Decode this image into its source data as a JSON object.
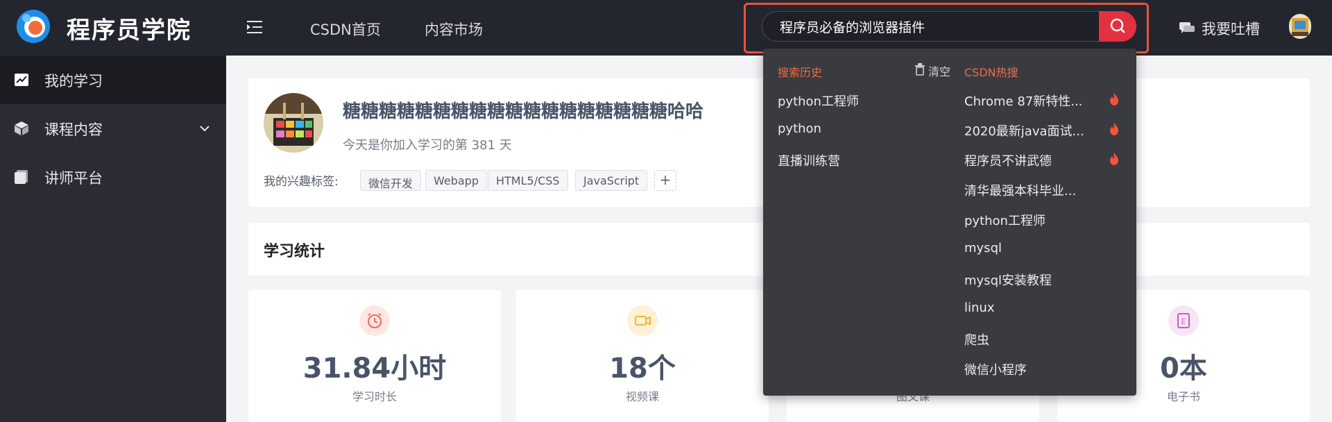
{
  "header": {
    "logo_text": "程序员学院",
    "nav": [
      "CSDN首页",
      "内容市场"
    ],
    "search": {
      "value": "程序员必备的浏览器插件"
    },
    "feedback_label": "我要吐槽"
  },
  "sidebar": {
    "items": [
      {
        "label": "我的学习",
        "icon": "chart-icon",
        "active": true
      },
      {
        "label": "课程内容",
        "icon": "cube-icon",
        "expandable": true
      },
      {
        "label": "讲师平台",
        "icon": "document-icon"
      }
    ]
  },
  "profile": {
    "name": "糖糖糖糖糖糖糖糖糖糖糖糖糖糖糖糖糖糖哈哈",
    "days_text": "今天是你加入学习的第 381 天",
    "tags_label": "我的兴趣标签:",
    "tags": [
      "微信开发",
      "Webapp",
      "HTML5/CSS",
      "JavaScript"
    ],
    "add_tag": "+"
  },
  "stats": {
    "title": "学习统计",
    "cards": [
      {
        "value": "31.84小时",
        "label": "学习时长",
        "icon": "alarm-clock-icon",
        "color": "#f0665c"
      },
      {
        "value": "18个",
        "label": "视频课",
        "icon": "video-icon",
        "color": "#f3b33a"
      },
      {
        "value": "",
        "label": "图文课",
        "icon": "article-icon",
        "color": "#5b8def"
      },
      {
        "value": "0本",
        "label": "电子书",
        "icon": "ebook-icon",
        "color": "#c45cc8"
      }
    ]
  },
  "dropdown": {
    "history_title": "搜索历史",
    "clear_label": "清空",
    "hot_title": "CSDN热搜",
    "history": [
      "python工程师",
      "python",
      "直播训练营"
    ],
    "hot": [
      {
        "text": "Chrome 87新特性...",
        "fire": true
      },
      {
        "text": "2020最新java面试...",
        "fire": true
      },
      {
        "text": "程序员不讲武德",
        "fire": true
      },
      {
        "text": "清华最强本科毕业...",
        "fire": false
      },
      {
        "text": "python工程师",
        "fire": false
      },
      {
        "text": "mysql",
        "fire": false
      },
      {
        "text": "mysql安装教程",
        "fire": false
      },
      {
        "text": "linux",
        "fire": false
      },
      {
        "text": "爬虫",
        "fire": false
      },
      {
        "text": "微信小程序",
        "fire": false
      }
    ]
  },
  "colors": {
    "accent": "#e3313f",
    "highlight": "#f06a48",
    "header_bg": "#24262f",
    "sidebar_bg": "#2b2c33"
  }
}
